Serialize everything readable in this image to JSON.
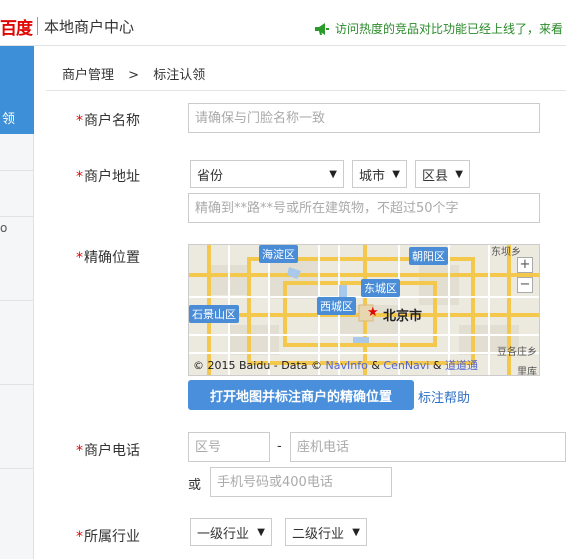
{
  "header": {
    "logo": "百度",
    "title": "本地商户中心",
    "notice": "访问热度的竞品对比功能已经上线了，来看"
  },
  "sidebar": {
    "active_fragment": "领",
    "fragments": [
      "o"
    ]
  },
  "breadcrumb": {
    "parent": "商户管理",
    "separator": ">",
    "current": "标注认领"
  },
  "form": {
    "required_mark": "*",
    "name": {
      "label": "商户名称",
      "placeholder": "请确保与门脸名称一致"
    },
    "address": {
      "label": "商户地址",
      "province": "省份",
      "city": "城市",
      "district": "区县",
      "detail_placeholder": "精确到**路**号或所在建筑物，不超过50个字"
    },
    "location": {
      "label": "精确位置",
      "button": "打开地图并标注商户的精确位置",
      "help": "标注帮助",
      "map": {
        "districts": [
          "海淀区",
          "朝阳区",
          "东城区",
          "西城区",
          "石景山区"
        ],
        "city": "北京市",
        "small_labels": [
          "东坝乡",
          "豆各庄乡",
          "里库"
        ],
        "zoom_in": "+",
        "zoom_out": "−",
        "copyright": "© 2015 Baidu - Data ©",
        "providers": [
          "NavInfo",
          "CenNavi",
          "道道通"
        ],
        "amp": "&"
      }
    },
    "phone": {
      "label": "商户电话",
      "area_placeholder": "区号",
      "dash": "-",
      "landline_placeholder": "座机电话",
      "or": "或",
      "mobile_placeholder": "手机号码或400电话"
    },
    "industry": {
      "label": "所属行业",
      "level1": "一级行业",
      "level2": "二级行业"
    }
  },
  "colors": {
    "accent": "#4a8fdb",
    "required": "#e10601",
    "notice": "#2a8a2a"
  }
}
